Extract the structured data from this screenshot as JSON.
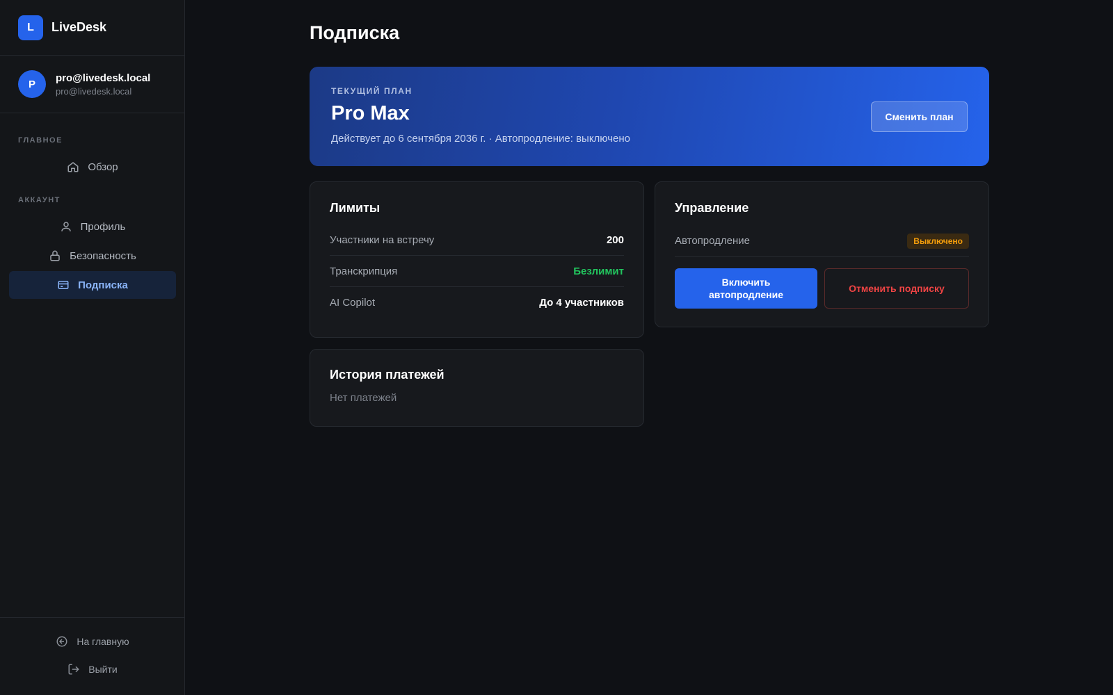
{
  "brand": {
    "logo_letter": "L",
    "name": "LiveDesk"
  },
  "user": {
    "avatar_letter": "P",
    "name": "pro@livedesk.local",
    "email": "pro@livedesk.local"
  },
  "nav": {
    "section_main": "ГЛАВНОЕ",
    "section_account": "АККАУНТ",
    "items": [
      {
        "label": "Обзор",
        "icon": "home-icon"
      },
      {
        "label": "Профиль",
        "icon": "user-icon"
      },
      {
        "label": "Безопасность",
        "icon": "lock-icon"
      },
      {
        "label": "Подписка",
        "icon": "card-icon",
        "active": true
      }
    ],
    "bottom": [
      {
        "label": "На главную",
        "icon": "arrow-left-circle-icon"
      },
      {
        "label": "Выйти",
        "icon": "logout-icon"
      }
    ]
  },
  "page": {
    "title": "Подписка"
  },
  "plan": {
    "label": "ТЕКУЩИЙ ПЛАН",
    "name": "Pro Max",
    "meta": "Действует до 6 сентября 2036 г. · Автопродление: выключено",
    "change_button": "Сменить план"
  },
  "limits": {
    "title": "Лимиты",
    "rows": [
      {
        "key": "Участники на встречу",
        "value": "200"
      },
      {
        "key": "Транскрипция",
        "value": "Безлимит"
      },
      {
        "key": "AI Copilot",
        "value": "До 4 участников"
      }
    ]
  },
  "manage": {
    "title": "Управление",
    "autorenew_label": "Автопродление",
    "autorenew_status": "Выключено",
    "enable_button_line1": "Включить",
    "enable_button_line2": "автопродление",
    "cancel_button": "Отменить подписку"
  },
  "history": {
    "title": "История платежей",
    "empty": "Нет платежей"
  },
  "colors": {
    "accent": "#2563eb",
    "success": "#22c55e",
    "warning": "#f59e0b",
    "danger": "#ef4444"
  }
}
